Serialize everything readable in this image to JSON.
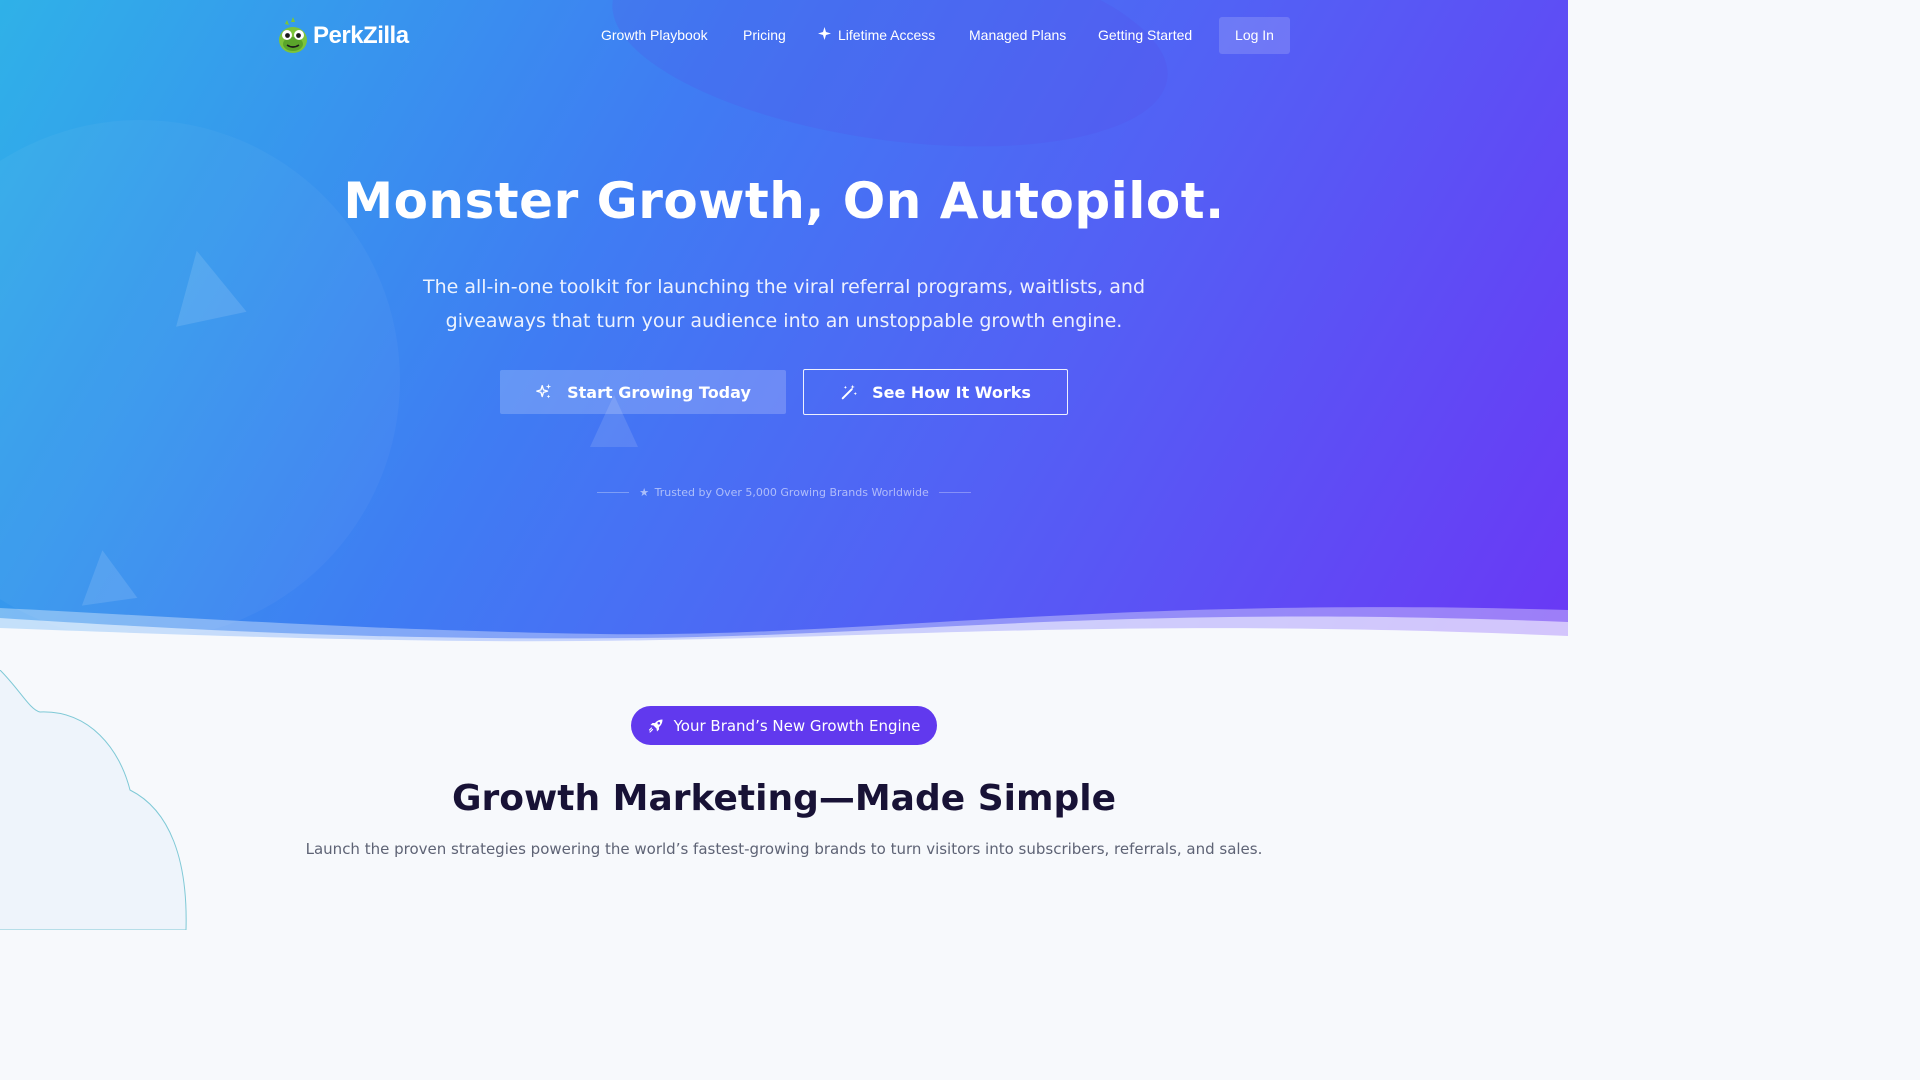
{
  "brand": {
    "name": "PerkZilla"
  },
  "nav": {
    "items": [
      {
        "label": "Growth Playbook"
      },
      {
        "label": "Pricing"
      },
      {
        "label": "Lifetime Access",
        "icon": "sparkle-icon"
      },
      {
        "label": "Managed Plans"
      },
      {
        "label": "Getting Started"
      }
    ],
    "login_label": "Log In"
  },
  "hero": {
    "title": "Monster Growth, On Autopilot.",
    "subtitle": "The all-in-one toolkit for launching the viral referral programs, waitlists, and giveaways that turn your audience into an unstoppable growth engine.",
    "primary_cta": {
      "label": "Start Growing Today",
      "icon": "sparkles-icon"
    },
    "secondary_cta": {
      "label": "See How It Works",
      "icon": "magic-wand-icon"
    },
    "trusted": {
      "text": "Trusted by Over 5,000 Growing Brands Worldwide",
      "icon": "star-icon"
    }
  },
  "section": {
    "badge": {
      "label": "Your Brand’s New Growth Engine",
      "icon": "rocket-icon"
    },
    "title": "Growth Marketing—Made Simple",
    "subtitle": "Launch the proven strategies powering the world’s fastest-growing brands to turn visitors into subscribers, referrals, and sales."
  },
  "colors": {
    "hero_gradient_start": "#2fb1e8",
    "hero_gradient_mid": "#4f6af4",
    "hero_gradient_end": "#6a38f5",
    "badge_bg": "#6139ee",
    "heading_dark": "#181236",
    "body_text": "#5e6375",
    "page_bg": "#f7f9fc"
  }
}
